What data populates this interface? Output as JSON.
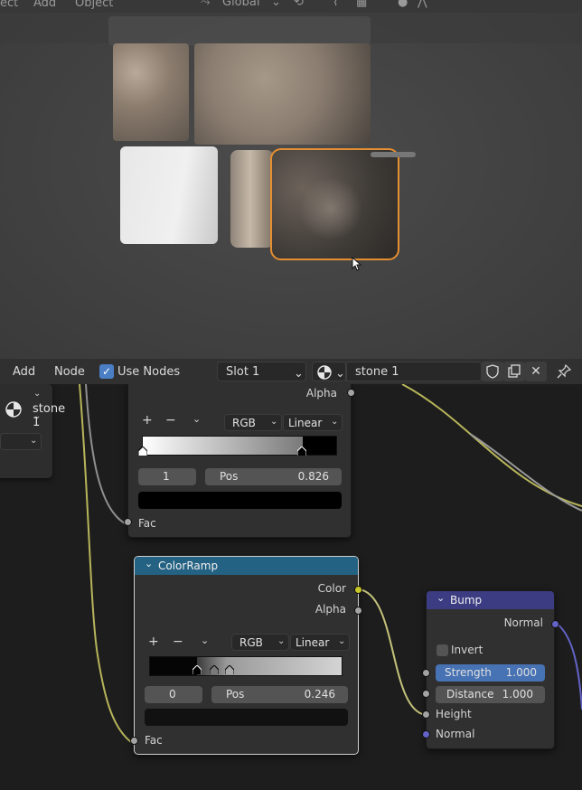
{
  "viewport": {
    "menu": [
      "ect",
      "Add",
      "Object"
    ],
    "orientation": "Global"
  },
  "node_header": {
    "add": "Add",
    "node": "Node",
    "use_nodes_label": "Use Nodes",
    "use_nodes_checked": true,
    "slot": "Slot 1",
    "material_name": "stone 1"
  },
  "left_panel": {
    "material_name": "stone 1"
  },
  "colorramp_top": {
    "alpha_output": "Alpha",
    "color_mode": "RGB",
    "interpolation": "Linear",
    "stop_index": "1",
    "pos_label": "Pos",
    "pos_value": "0.826",
    "fac_input": "Fac"
  },
  "colorramp_main": {
    "title": "ColorRamp",
    "color_output": "Color",
    "alpha_output": "Alpha",
    "color_mode": "RGB",
    "interpolation": "Linear",
    "stop_index": "0",
    "pos_label": "Pos",
    "pos_value": "0.246",
    "fac_input": "Fac"
  },
  "bump": {
    "title": "Bump",
    "normal_output": "Normal",
    "invert_label": "Invert",
    "invert_checked": false,
    "strength_label": "Strength",
    "strength_value": "1.000",
    "distance_label": "Distance",
    "distance_value": "1.000",
    "height_input": "Height",
    "normal_input": "Normal"
  },
  "colors": {
    "accent_blue": "#4772b3",
    "selection_orange": "#e58f32",
    "colorramp_header": "#246283",
    "bump_header": "#3c3c83",
    "socket_yellow": "#c7c729",
    "socket_purple": "#6363c7"
  }
}
